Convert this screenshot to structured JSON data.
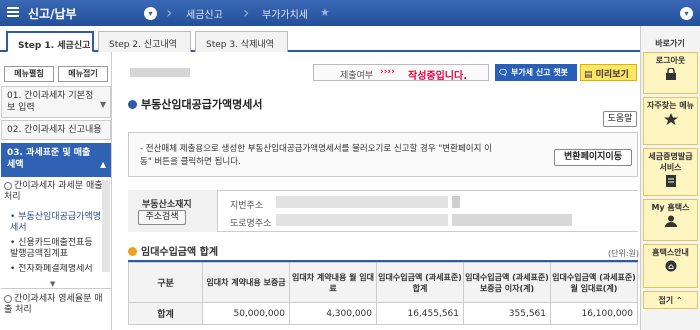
{
  "topbar": {
    "section": "신고/납부",
    "crumb2": "세금신고",
    "crumb3": "부가가치세"
  },
  "tabs": [
    "Step 1. 세금신고",
    "Step 2. 신고내역",
    "Step 3. 삭제내역"
  ],
  "left_nav": {
    "menu_open": "메뉴펼침",
    "menu_close": "메뉴접기",
    "item1": "01. 간이과세자 기본정보 입력",
    "item2": "02. 간이과세자 신고내용",
    "item3": "03. 과세표준 및 매출세액",
    "sub1": "간이과세자 과세분 매출 처리",
    "sub1a": "부동산임대공급가액명세서",
    "sub1b": "신용카드매출전표등 발행금액집계표",
    "sub1c": "전자화폐결제명세서",
    "sub2": "간이과세자 영세율분 매출 처리"
  },
  "status": {
    "label": "제출여부",
    "arrows": "››››",
    "value": "작성중입니다.",
    "guide_button": "부가세 신고 챗봇",
    "preview_button": "미리보기"
  },
  "page": {
    "title": "부동산임대공급가액명세서",
    "help_button": "도움말",
    "notice": "- 전산매체 제출용으로 생성한 부동산임대공급가액명세서를 불러오기로 신고할 경우 \"변환페이지 이동\" 버튼을 클릭하면 됩니다.",
    "convert_button": "변환페이지이동"
  },
  "address": {
    "label": "부동산소재지",
    "search_button": "주소검색",
    "jibun_label": "지번주소",
    "road_label": "도로명주소"
  },
  "summary": {
    "title": "임대수입금액 합계",
    "unit": "(단위:원)",
    "headers": [
      "구분",
      "임대차 계약내용 보증금",
      "임대차 계약내용 월 임대료",
      "임대수입금액 (과세표준) 합계",
      "임대수입금액 (과세표준) 보증금 이자(계)",
      "임대수입금액 (과세표준) 월 임대료(계)"
    ],
    "row_label": "합계",
    "values": [
      "50,000,000",
      "4,300,000",
      "16,455,561",
      "355,561",
      "16,100,000"
    ]
  },
  "right_sidebar": {
    "title": "바로가기",
    "logout": "로그아웃",
    "faq": "자주찾는 메뉴",
    "cert": "세금증명발급 서비스",
    "my": "My 홈택스",
    "guide": "홈택스안내",
    "fold": "접기"
  },
  "colors": {
    "brand": "#2d5aa6",
    "accent": "#e8003a",
    "highlight": "#fff5c0"
  }
}
